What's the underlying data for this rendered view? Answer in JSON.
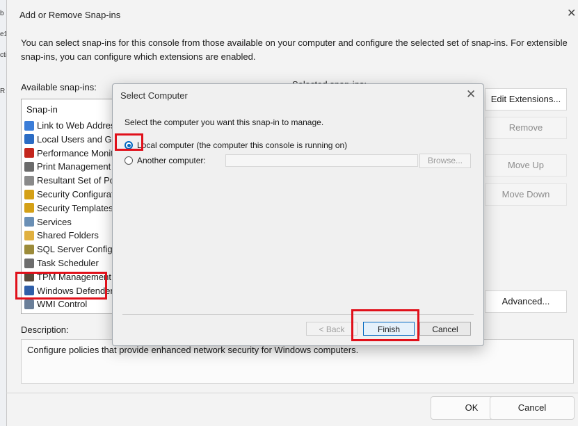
{
  "main_dialog": {
    "title": "Add or Remove Snap-ins",
    "close_glyph": "✕",
    "intro": "You can select snap-ins for this console from those available on your computer and configure the selected set of snap-ins. For extensible snap-ins, you can configure which extensions are enabled.",
    "available_label": "Available snap-ins:",
    "selected_label": "Selected snap-ins:",
    "snapin_header": "Snap-in",
    "snapins": [
      {
        "label": "Link to Web Address",
        "icon": "web-link-icon",
        "color": "#3b7dd8"
      },
      {
        "label": "Local Users and Groups",
        "icon": "users-icon",
        "color": "#2b6cc4"
      },
      {
        "label": "Performance Monitor",
        "icon": "performance-icon",
        "color": "#c4261d"
      },
      {
        "label": "Print Management",
        "icon": "printer-icon",
        "color": "#6b6b6b"
      },
      {
        "label": "Resultant Set of Policy",
        "icon": "policy-icon",
        "color": "#8a8a8a"
      },
      {
        "label": "Security Configuration",
        "icon": "security-config-icon",
        "color": "#d4a017"
      },
      {
        "label": "Security Templates",
        "icon": "security-templates-icon",
        "color": "#d4a017"
      },
      {
        "label": "Services",
        "icon": "services-gear-icon",
        "color": "#6a8fb5"
      },
      {
        "label": "Shared Folders",
        "icon": "shared-folder-icon",
        "color": "#e0b040"
      },
      {
        "label": "SQL Server Configuration",
        "icon": "sql-server-icon",
        "color": "#9c8b3a"
      },
      {
        "label": "Task Scheduler",
        "icon": "clock-icon",
        "color": "#6d6d6d"
      },
      {
        "label": "TPM Management",
        "icon": "tpm-chip-icon",
        "color": "#5a4a3a"
      },
      {
        "label": "Windows Defender Firewall",
        "icon": "firewall-icon",
        "color": "#2f5ea8"
      },
      {
        "label": "WMI Control",
        "icon": "wmi-icon",
        "color": "#6b7f99"
      }
    ],
    "buttons": {
      "edit_extensions": "Edit Extensions...",
      "remove": "Remove",
      "move_up": "Move Up",
      "move_down": "Move Down",
      "advanced": "Advanced...",
      "ok": "OK",
      "cancel": "Cancel"
    },
    "description_label": "Description:",
    "description": "Configure policies that provide enhanced network security for Windows computers."
  },
  "modal": {
    "title": "Select Computer",
    "close_glyph": "✕",
    "prompt": "Select the computer you want this snap-in to manage.",
    "options": [
      {
        "label": "Local computer (the computer this console is running on)",
        "checked": true
      },
      {
        "label": "Another computer:",
        "checked": false
      }
    ],
    "computer_value": "",
    "browse": "Browse...",
    "back": "< Back",
    "finish": "Finish",
    "cancel": "Cancel"
  },
  "background_window": {
    "fragments": [
      "b",
      "e1",
      "cti",
      "R"
    ]
  },
  "colors": {
    "highlight": "#e0101a",
    "accent": "#0067c0"
  }
}
